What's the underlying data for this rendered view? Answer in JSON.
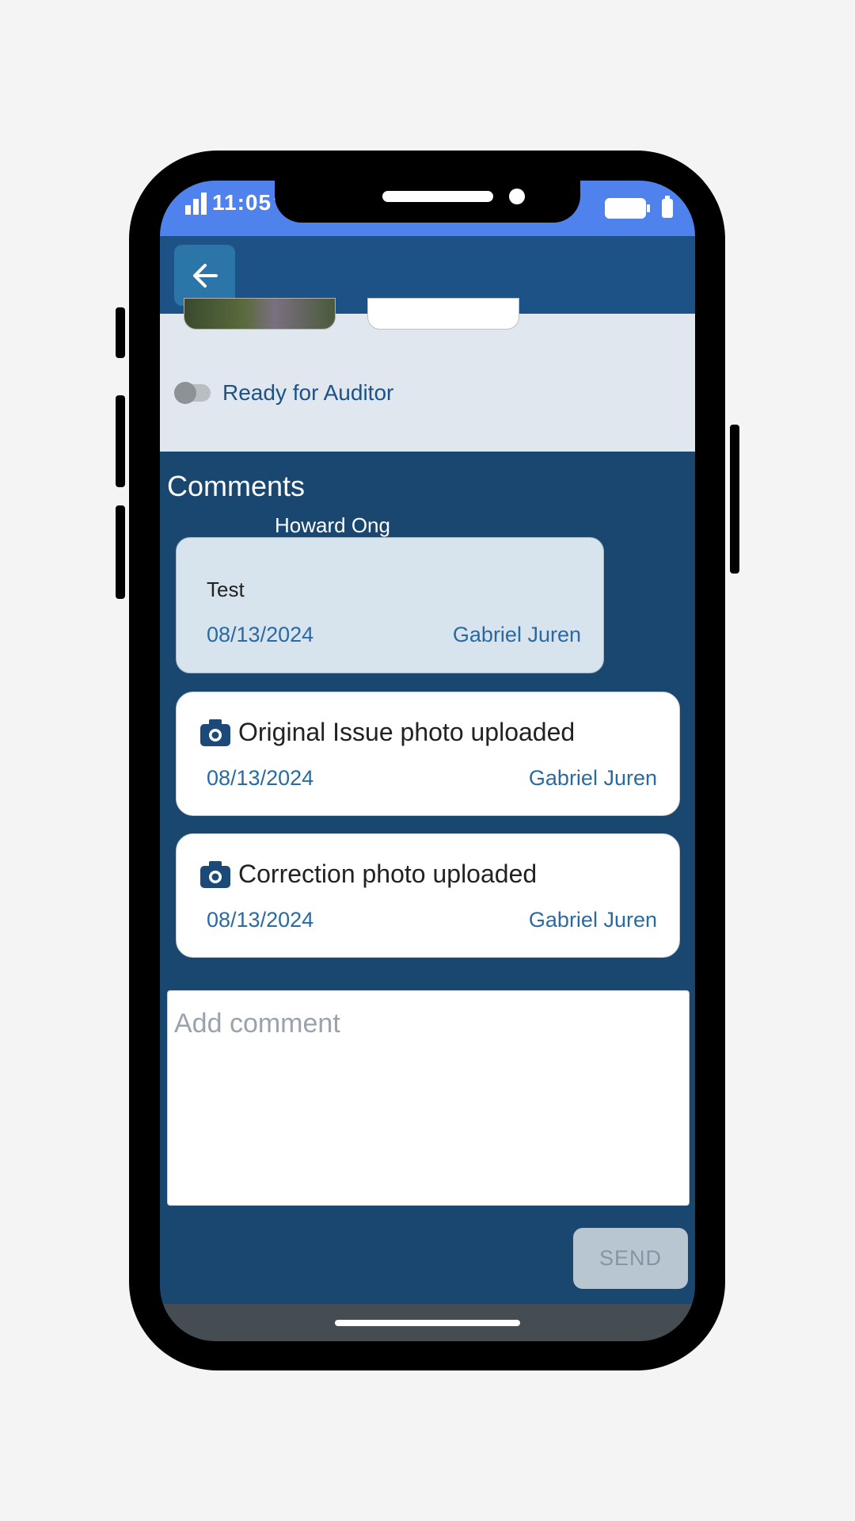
{
  "status_bar": {
    "time": "11:05"
  },
  "app_bar": {
    "back_icon": "arrow-left-icon"
  },
  "auditor_toggle": {
    "label": "Ready for Auditor",
    "checked": false
  },
  "comments": {
    "title": "Comments",
    "thread": [
      {
        "type": "comment",
        "header_author": "Howard Ong",
        "text": "Test",
        "date": "08/13/2024",
        "author": "Gabriel Juren"
      },
      {
        "type": "activity",
        "icon": "camera-icon",
        "text": "Original Issue photo uploaded",
        "date": "08/13/2024",
        "author": "Gabriel Juren"
      },
      {
        "type": "activity",
        "icon": "camera-icon",
        "text": "Correction photo uploaded",
        "date": "08/13/2024",
        "author": "Gabriel Juren"
      }
    ]
  },
  "composer": {
    "placeholder": "Add comment",
    "send_label": "SEND"
  },
  "colors": {
    "status_bar": "#4f82ec",
    "app_bar": "#1c5286",
    "comments_bg": "#194770",
    "accent_text": "#2a6aa3"
  }
}
